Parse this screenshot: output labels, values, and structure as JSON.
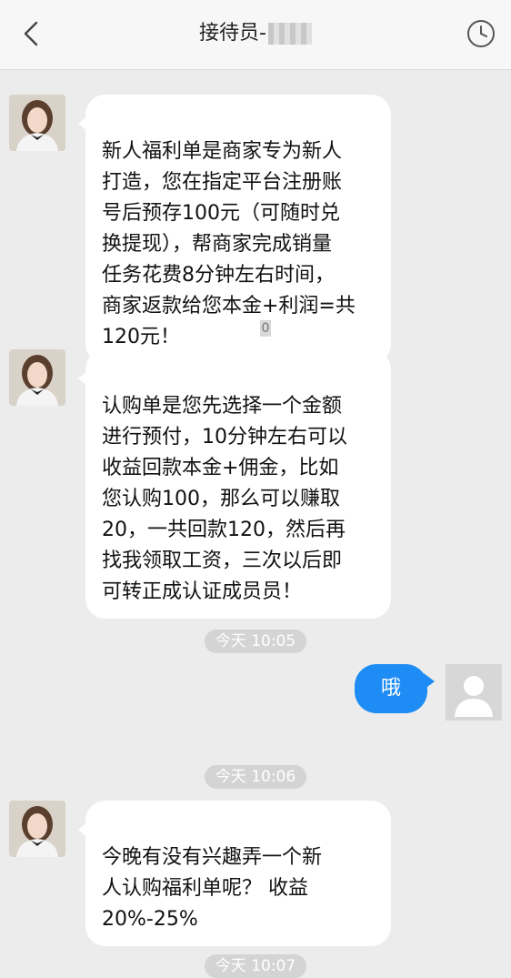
{
  "header": {
    "title": "接待员-",
    "back_icon": "chevron-left-icon",
    "history_icon": "clock-icon"
  },
  "messages": [
    {
      "sender": "agent",
      "text": "新人福利单是商家专为新人\n打造，您在指定平台注册账\n号后预存100元（可随时兑\n换提现），帮商家完成销量\n任务花费8分钟左右时间，\n商家返款给您本金+利润=共\n120元！"
    },
    {
      "sender": "agent",
      "text": "认购单是您先选择一个金额\n进行预付，10分钟左右可以\n收益回款本金+佣金，比如\n您认购100，那么可以赚取\n20，一共回款120，然后再\n找我领取工资，三次以后即\n可转正成认证成员员！"
    },
    {
      "sender": "me",
      "text": "哦"
    },
    {
      "sender": "agent",
      "text": "今晚有没有兴趣弄一个新\n人认购福利单呢？ 收益\n20%-25%"
    }
  ],
  "marker_text": "0",
  "timestamps": [
    "今天 10:05",
    "今天 10:06",
    "今天 10:07"
  ],
  "colors": {
    "background": "#ececec",
    "my_bubble": "#1e8cf5",
    "agent_bubble": "#ffffff"
  }
}
